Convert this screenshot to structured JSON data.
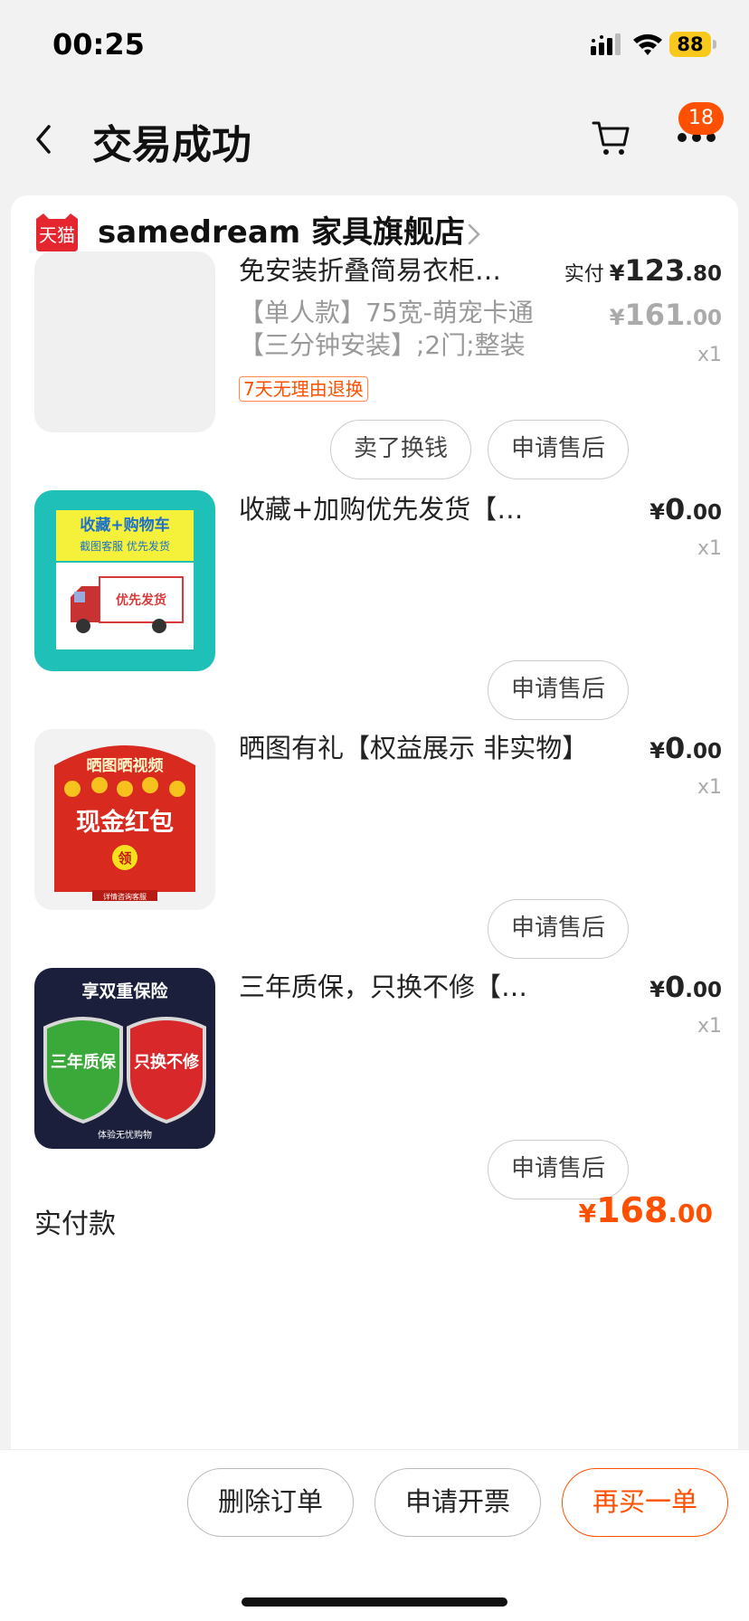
{
  "status_bar": {
    "time": "00:25",
    "battery": "88"
  },
  "nav": {
    "title": "交易成功",
    "badge_count": "18"
  },
  "shop": {
    "logo_text": "天猫",
    "name": "samedream 家具旗舰店"
  },
  "items": [
    {
      "title": "免安装折叠简易衣柜…",
      "sku_line1": "【单人款】75宽-萌宠卡通",
      "sku_line2": "【三分钟安装】;2门;整装",
      "tag": "7天无理由退换",
      "paid_label": "实付",
      "currency": "¥",
      "price_int": "123",
      "price_dec": ".80",
      "orig_int": "161",
      "orig_dec": ".00",
      "qty": "x1",
      "buttons": [
        "卖了换钱",
        "申请售后"
      ]
    },
    {
      "title": "收藏+加购优先发货【权益…",
      "currency": "¥",
      "price_int": "0",
      "price_dec": ".00",
      "qty": "x1",
      "thumb_line1": "收藏+购物车",
      "thumb_line2": "截图客服 优先发货",
      "thumb_truck_label": "优先发货",
      "buttons": [
        "申请售后"
      ]
    },
    {
      "title": "晒图有礼【权益展示  非实物】",
      "currency": "¥",
      "price_int": "0",
      "price_dec": ".00",
      "qty": "x1",
      "thumb_line1": "晒图晒视频",
      "thumb_line2": "现金红包",
      "thumb_badge": "领",
      "thumb_footer": "详情咨询客服",
      "buttons": [
        "申请售后"
      ]
    },
    {
      "title": "三年质保，只换不修【权益…",
      "currency": "¥",
      "price_int": "0",
      "price_dec": ".00",
      "qty": "x1",
      "thumb_line1": "享双重保险",
      "thumb_shield1": "三年质保",
      "thumb_shield2": "只换不修",
      "thumb_footer": "体验无忧购物",
      "buttons": [
        "申请售后"
      ]
    }
  ],
  "total": {
    "label": "实付款",
    "currency": "¥",
    "int": "168",
    "dec": ".00"
  },
  "bottom": {
    "delete": "删除订单",
    "invoice": "申请开票",
    "rebuy": "再买一单"
  },
  "colors": {
    "accent": "#ff5000",
    "tmall_red": "#e5262e"
  }
}
